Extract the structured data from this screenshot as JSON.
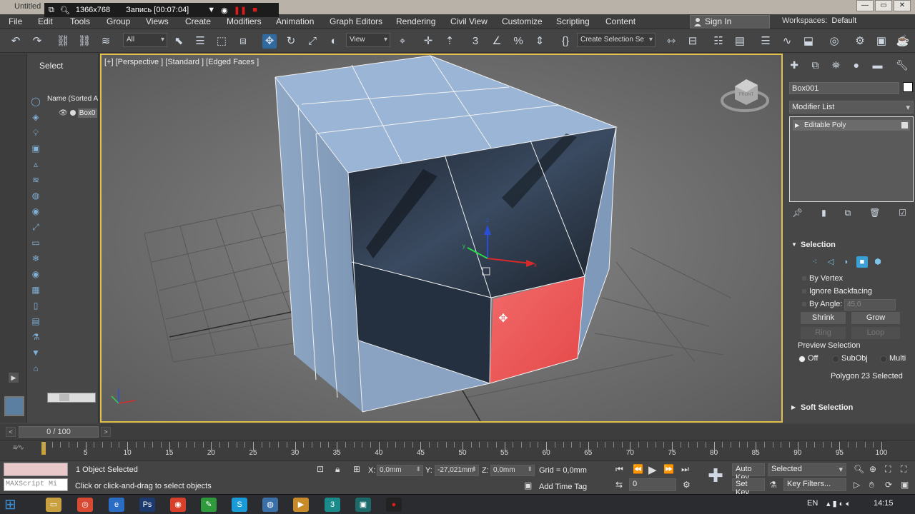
{
  "titlebar": {
    "app_title": "Untitled"
  },
  "recorder": {
    "resolution": "1366x768",
    "status": "Запись [00:07:04]"
  },
  "menu": {
    "items": [
      "File",
      "Edit",
      "Tools",
      "Group",
      "Views",
      "Create",
      "Modifiers",
      "Animation",
      "Graph Editors",
      "Rendering",
      "Civil View",
      "Customize",
      "Scripting",
      "Content"
    ],
    "sign_in": "Sign In",
    "workspaces_label": "Workspaces:",
    "workspaces_value": "Default"
  },
  "toolbar": {
    "filter": "All",
    "ref_coord": "View",
    "selection_set": "Create Selection Se"
  },
  "explorer": {
    "title": "Select",
    "column_header": "Name (Sorted A",
    "objects": [
      "Box0"
    ]
  },
  "viewport": {
    "label": "[+] [Perspective ] [Standard ] [Edged Faces ]",
    "viewcube_text": "FRONT"
  },
  "cmdpanel": {
    "object_name": "Box001",
    "object_color": "#ffffff",
    "modifier_list": "Modifier List",
    "stack": [
      "Editable Poly"
    ],
    "selection": {
      "title": "Selection",
      "by_vertex": "By Vertex",
      "ignore_backfacing": "Ignore Backfacing",
      "by_angle": "By Angle:",
      "angle_value": "45,0",
      "shrink": "Shrink",
      "grow": "Grow",
      "ring": "Ring",
      "loop": "Loop",
      "preview_selection": "Preview Selection",
      "preview_options": [
        "Off",
        "SubObj",
        "Multi"
      ],
      "preview_active": "Off",
      "status": "Polygon 23 Selected"
    },
    "soft_selection": "Soft Selection"
  },
  "timeline": {
    "position": "0 / 100",
    "current_frame": 0,
    "total_frames": 100,
    "ticks": [
      0,
      5,
      10,
      15,
      20,
      25,
      30,
      35,
      40,
      45,
      50,
      55,
      60,
      65,
      70,
      75,
      80,
      85,
      90,
      95,
      100
    ]
  },
  "status": {
    "maxscript_placeholder": "MAXScript Mi",
    "objects_selected": "1 Object Selected",
    "prompt": "Click or click-and-drag to select objects",
    "x_label": "X:",
    "x_value": "0,0mm",
    "y_label": "Y:",
    "y_value": "-27,021mm",
    "z_label": "Z:",
    "z_value": "0,0mm",
    "grid": "Grid = 0,0mm",
    "add_time_tag": "Add Time Tag",
    "auto_key": "Auto Key",
    "set_key": "Set Key",
    "key_mode": "Selected",
    "key_filters": "Key Filters...",
    "frame_value": "0"
  },
  "taskbar": {
    "lang": "EN",
    "time": "14:15"
  },
  "colors": {
    "viewport_border": "#e3c04a",
    "selected_polygon": "#f05a5a",
    "box_face": "#8aa6c8"
  }
}
